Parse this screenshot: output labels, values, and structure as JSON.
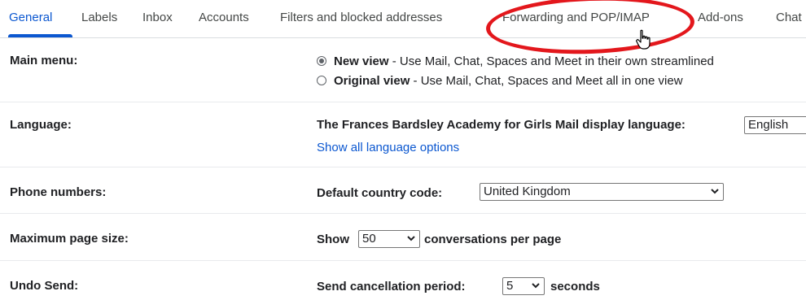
{
  "tabs": [
    {
      "label": "General",
      "active": true
    },
    {
      "label": "Labels"
    },
    {
      "label": "Inbox"
    },
    {
      "label": "Accounts"
    },
    {
      "label": "Filters and blocked addresses"
    },
    {
      "label": "Forwarding and POP/IMAP"
    },
    {
      "label": "Add-ons"
    },
    {
      "label": "Chat"
    }
  ],
  "main_menu": {
    "label": "Main menu:",
    "options": [
      {
        "title": "New view",
        "desc": " - Use Mail, Chat, Spaces and Meet in their own streamlined",
        "selected": true
      },
      {
        "title": "Original view",
        "desc": " - Use Mail, Chat, Spaces and Meet all in one view",
        "selected": false
      }
    ]
  },
  "language": {
    "label": "Language:",
    "prompt": "The Frances Bardsley Academy for Girls Mail display language:",
    "value": "English",
    "link": "Show all language options"
  },
  "phone": {
    "label": "Phone numbers:",
    "prompt": "Default country code:",
    "value": "United Kingdom"
  },
  "page_size": {
    "label": "Maximum page size:",
    "prefix": "Show",
    "value": "50",
    "suffix": "conversations per page"
  },
  "undo_send": {
    "label": "Undo Send:",
    "prompt": "Send cancellation period:",
    "value": "5",
    "suffix": "seconds"
  },
  "colors": {
    "accent": "#0b57d0",
    "annotation": "#e3171c"
  }
}
